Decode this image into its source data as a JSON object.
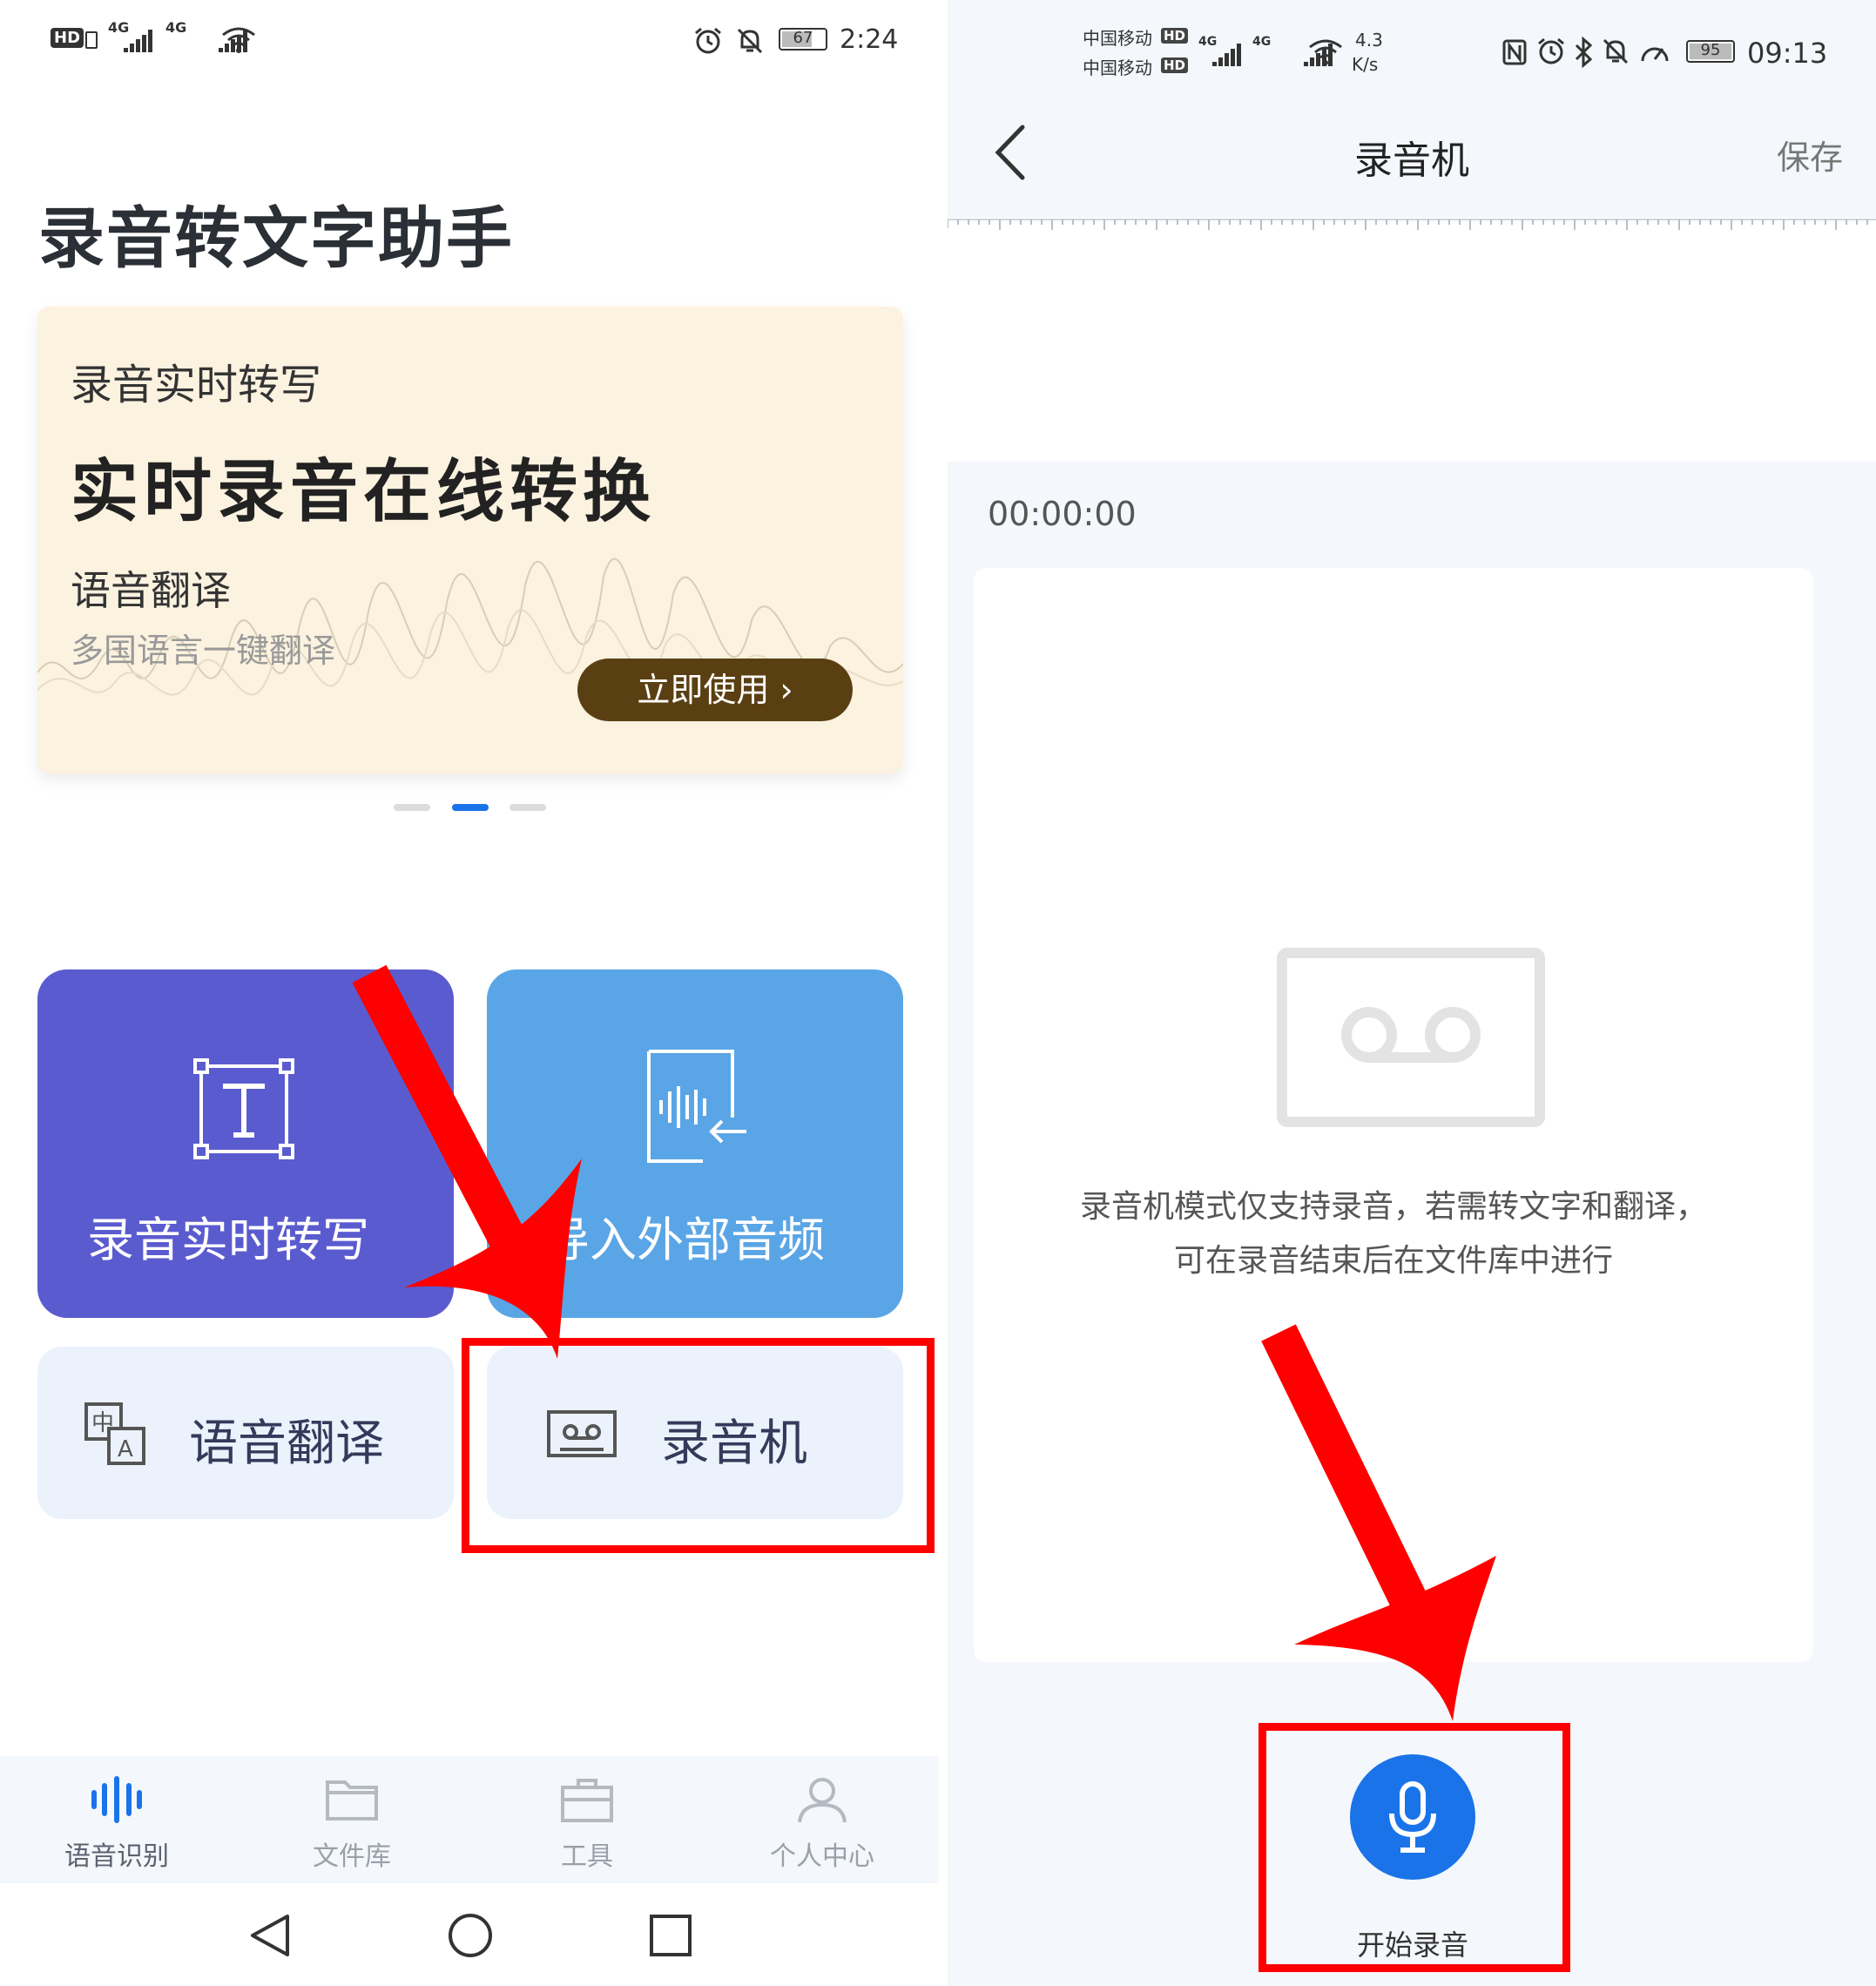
{
  "left_screen": {
    "status_bar": {
      "hd_badge": "HD",
      "network_1": "4G",
      "network_2": "4G",
      "battery": "67",
      "time": "2:24",
      "icons": [
        "wifi-icon",
        "alarm-icon",
        "mute-icon",
        "battery-icon"
      ]
    },
    "app_title": "录音转文字助手",
    "banner": {
      "subtitle": "录音实时转写",
      "headline": "实时录音在线转换",
      "feature_title": "语音翻译",
      "feature_desc": "多国语言一键翻译",
      "cta_label": "立即使用 ›",
      "active_dot_index": 1,
      "dot_count": 3
    },
    "tiles": {
      "realtime_label": "录音实时转写",
      "import_label": "导入外部音频",
      "translate_label": "语音翻译",
      "recorder_label": "录音机"
    },
    "bottom_nav": [
      {
        "label": "语音识别",
        "icon": "waveform-icon",
        "active": true
      },
      {
        "label": "文件库",
        "icon": "folder-icon",
        "active": false
      },
      {
        "label": "工具",
        "icon": "toolbox-icon",
        "active": false
      },
      {
        "label": "个人中心",
        "icon": "user-icon",
        "active": false
      }
    ],
    "system_nav": [
      "back-triangle-icon",
      "home-circle-icon",
      "recents-square-icon"
    ]
  },
  "right_screen": {
    "status_bar": {
      "carrier_1": "中国移动",
      "carrier_2": "中国移动",
      "hd_1": "HD",
      "hd_2": "HD",
      "network_1": "4G",
      "network_2": "4G",
      "speed_value": "4.3",
      "speed_unit": "K/s",
      "battery": "95",
      "time": "09:13",
      "icons": [
        "nfc-icon",
        "alarm-icon",
        "bluetooth-icon",
        "mute-icon",
        "speed-icon",
        "battery-icon"
      ]
    },
    "header": {
      "back_icon": "chevron-left-icon",
      "title": "录音机",
      "save_label": "保存"
    },
    "timer": "00:00:00",
    "empty_state": {
      "icon": "cassette-icon",
      "line1": "录音机模式仅支持录音，若需转文字和翻译，",
      "line2": "可在录音结束后在文件库中进行"
    },
    "record_button": {
      "icon": "microphone-icon",
      "label": "开始录音"
    }
  },
  "colors": {
    "tile_purple": "#5b5bd0",
    "tile_blue": "#5aa5e6",
    "tile_light": "#ecf2fc",
    "banner_bg": "#fbf2e0",
    "cta_brown": "#5a3f12",
    "accent_blue": "#1a73e8",
    "annotation_red": "#ff0000"
  }
}
